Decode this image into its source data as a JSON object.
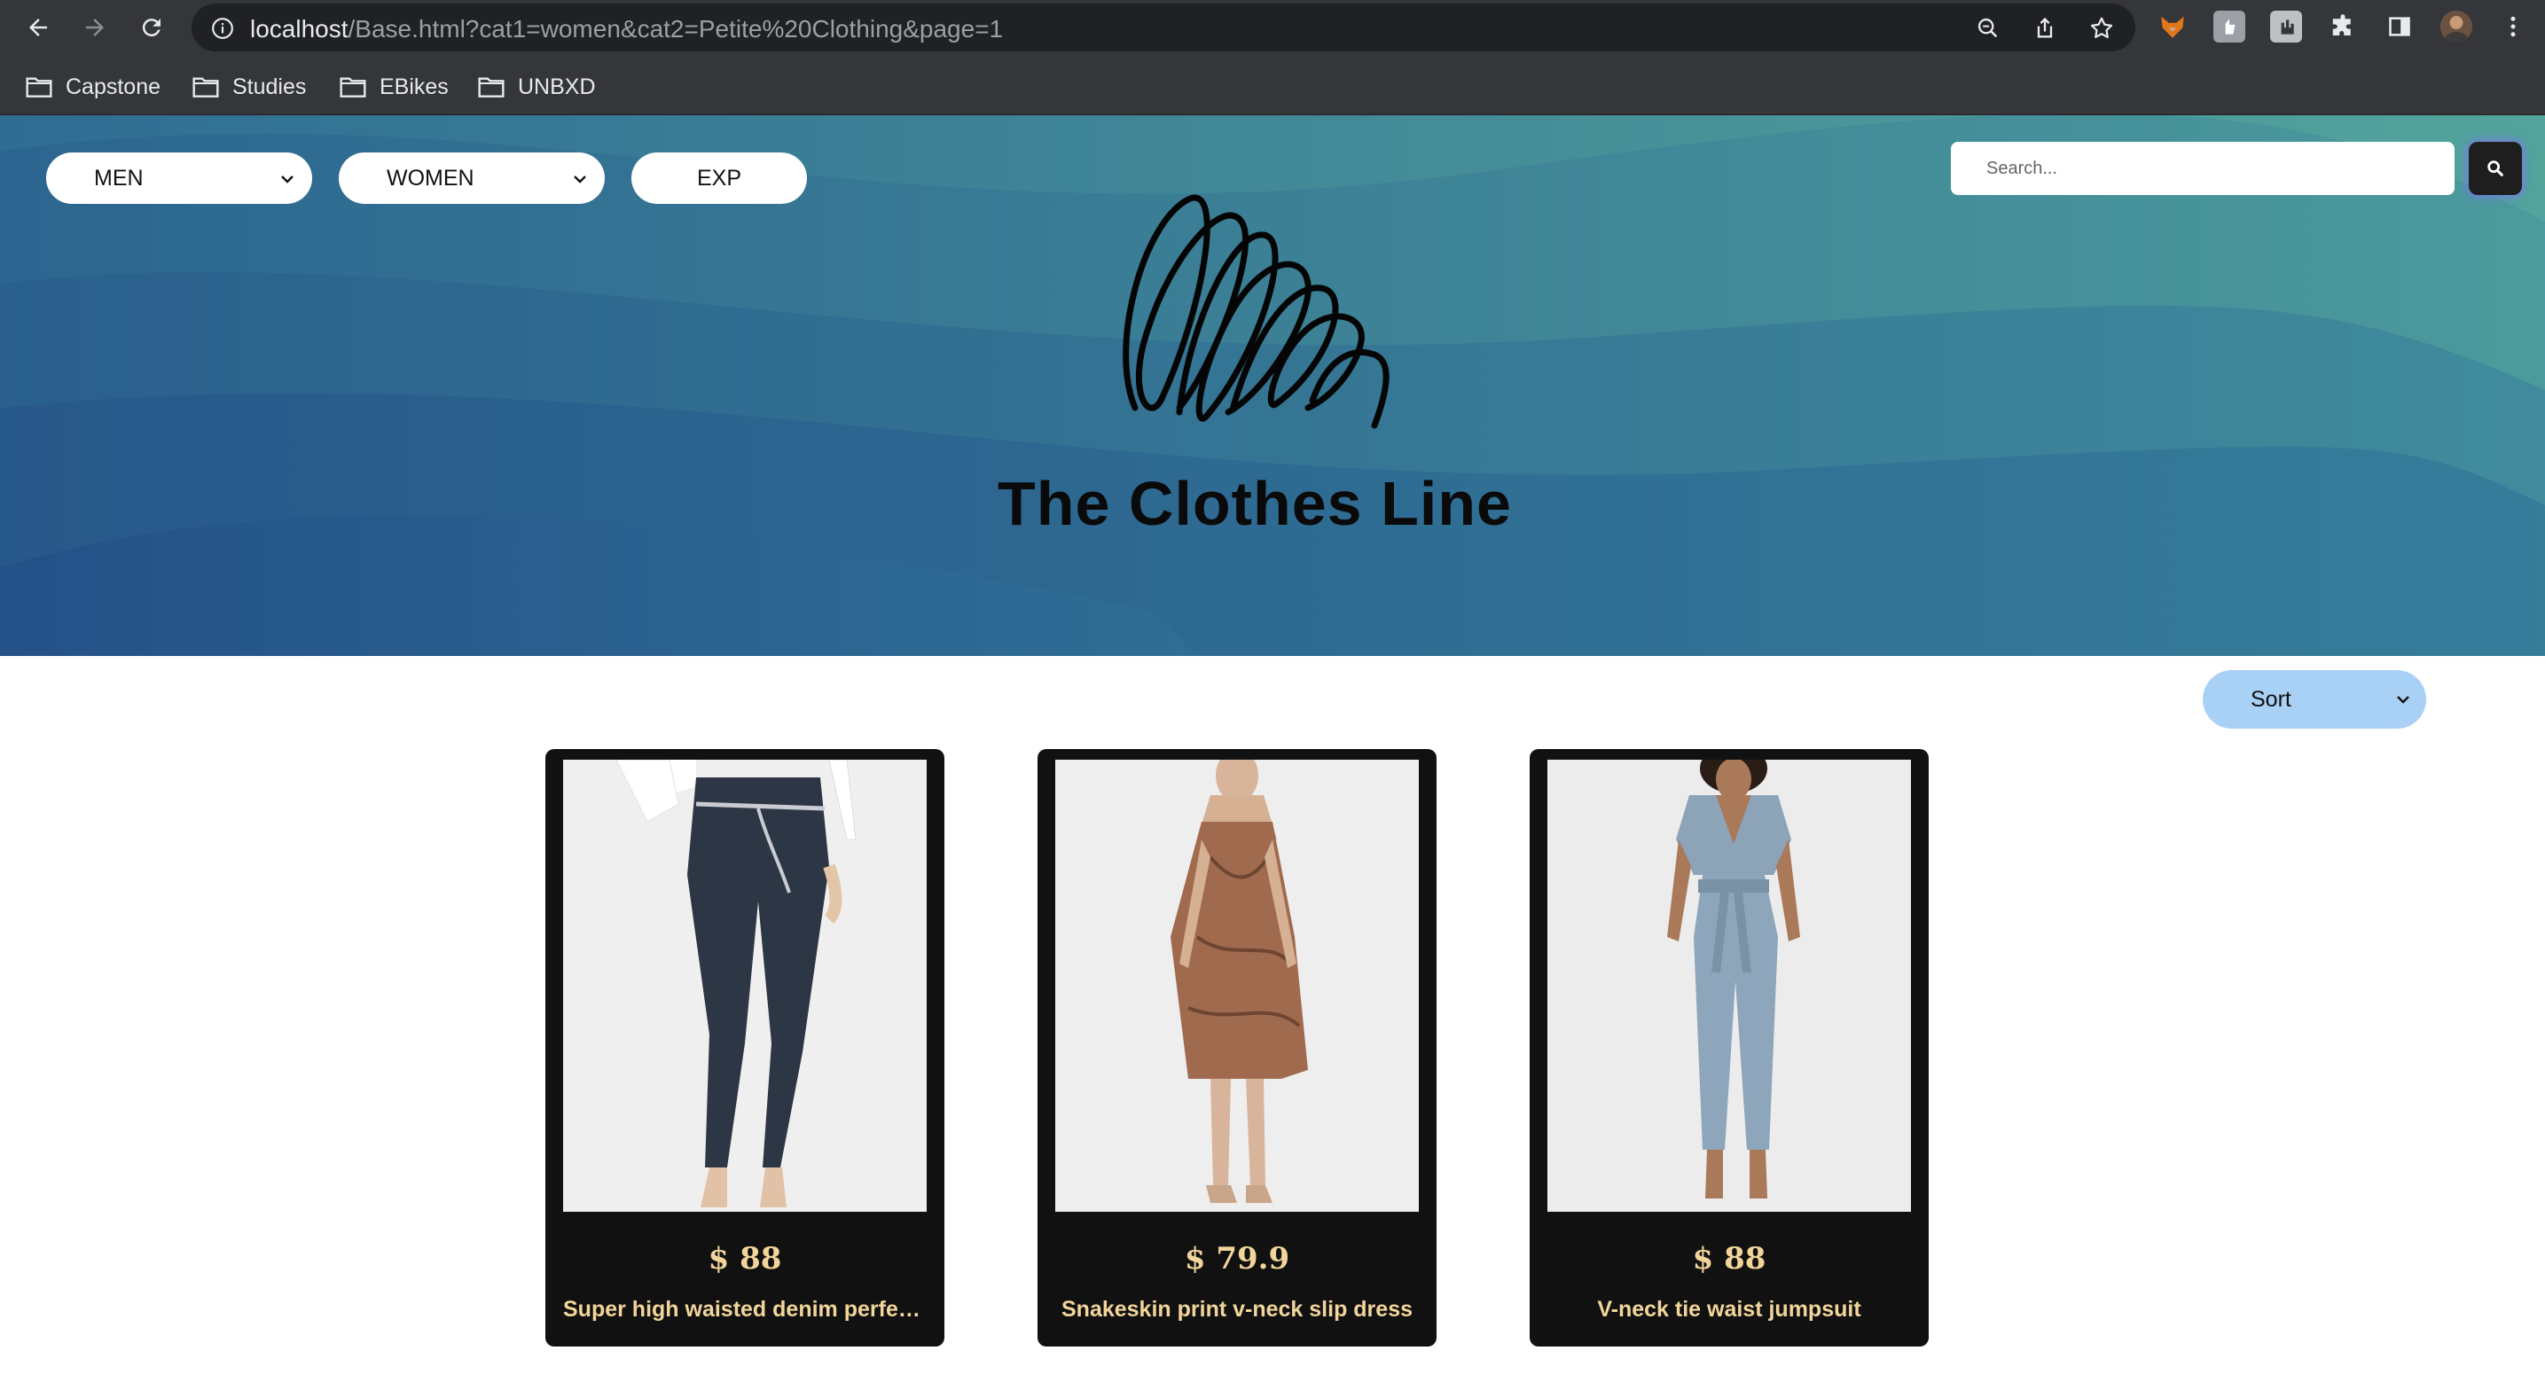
{
  "browser": {
    "url_host": "localhost",
    "url_path": "/Base.html?cat1=women&cat2=Petite%20Clothing&page=1",
    "bookmarks": [
      {
        "label": "Capstone",
        "icon": "folder-icon"
      },
      {
        "label": "Studies",
        "icon": "folder-icon"
      },
      {
        "label": "EBikes",
        "icon": "folder-icon"
      },
      {
        "label": "UNBXD",
        "icon": "folder-icon"
      }
    ]
  },
  "nav": {
    "men_label": "MEN",
    "women_label": "WOMEN",
    "exp_label": "EXP"
  },
  "search": {
    "placeholder": "Search..."
  },
  "brand": {
    "name": "The Clothes Line"
  },
  "sort": {
    "label": "Sort"
  },
  "products": [
    {
      "price": "$ 88",
      "name": "Super high waisted denim perfec...",
      "image": "jeans-photo"
    },
    {
      "price": "$ 79.9",
      "name": "Snakeskin print v-neck slip dress",
      "image": "dress-photo"
    },
    {
      "price": "$ 88",
      "name": "V-neck tie waist jumpsuit",
      "image": "jumpsuit-photo"
    }
  ],
  "colors": {
    "chrome_bg": "#35363a",
    "hero_teal": "#4fa39e",
    "hero_blue": "#2b5e8c",
    "card_bg": "#111111",
    "card_text": "#f2d59a",
    "sort_bg": "#a9d0f5"
  }
}
